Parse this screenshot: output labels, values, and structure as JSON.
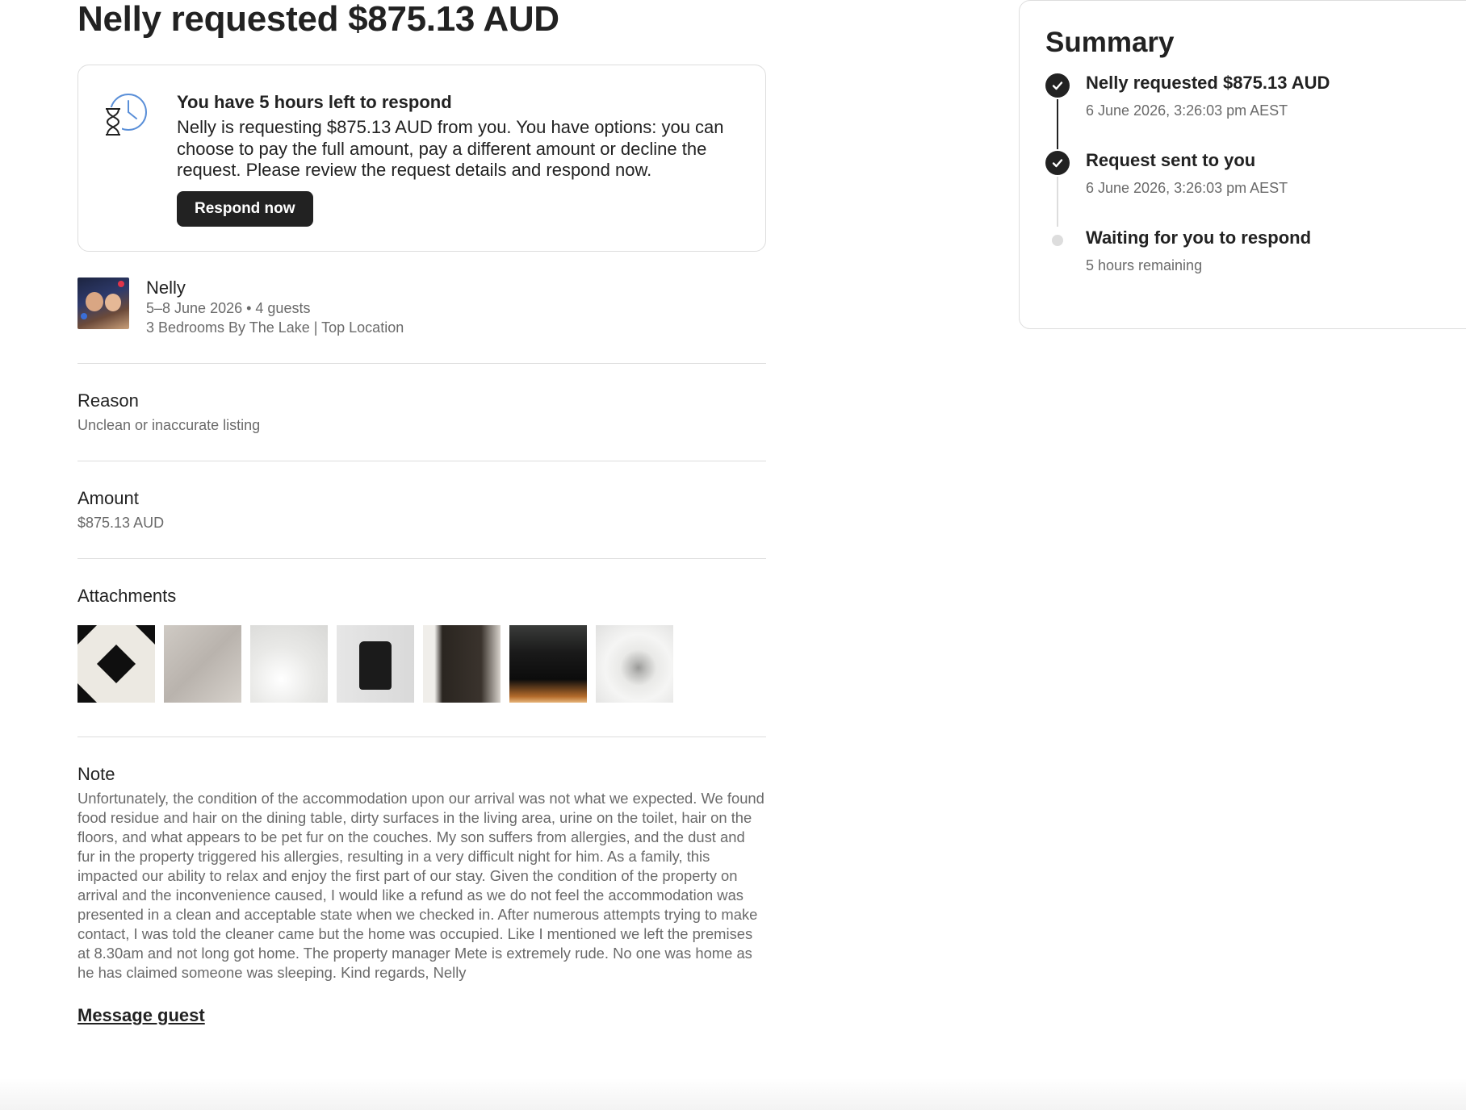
{
  "page": {
    "title": "Nelly requested $875.13 AUD"
  },
  "alert": {
    "heading": "You have 5 hours left to respond",
    "body": "Nelly is requesting $875.13 AUD from you. You have options: you can choose to pay the full amount, pay a different amount or decline the request. Please review the request details and respond now.",
    "button_label": "Respond now",
    "icon": "clock-hourglass-icon"
  },
  "guest": {
    "name": "Nelly",
    "dates_guests": "5–8 June 2026 • 4 guests",
    "listing": "3 Bedrooms By The Lake | Top Location"
  },
  "reason": {
    "label": "Reason",
    "value": "Unclean or inaccurate listing"
  },
  "amount": {
    "label": "Amount",
    "value": "$875.13 AUD"
  },
  "attachments": {
    "label": "Attachments",
    "count": 7
  },
  "note": {
    "label": "Note",
    "text": "Unfortunately, the condition of the accommodation upon our arrival was not what we expected. We found food residue and hair on the dining table, dirty surfaces in the living area, urine on the toilet, hair on the floors, and what appears to be pet fur on the couches. My son suffers from allergies, and the dust and fur in the property triggered his allergies, resulting in a very difficult night for him. As a family, this impacted our ability to relax and enjoy the first part of our stay. Given the condition of the property on arrival and the inconvenience caused, I would like a refund as we do not feel the accommodation was presented in a clean and acceptable state when we checked in. After numerous attempts trying to make contact, I was told the cleaner came but the home was occupied. Like I mentioned we left the premises at 8.30am and not long got home. The property manager Mete is extremely rude. No one was home as he has claimed someone was sleeping. Kind regards, Nelly"
  },
  "message_link": "Message guest",
  "summary": {
    "title": "Summary",
    "steps": [
      {
        "title": "Nelly requested $875.13 AUD",
        "subtitle": "6 June 2026, 3:26:03 pm AEST",
        "status": "done"
      },
      {
        "title": "Request sent to you",
        "subtitle": "6 June 2026, 3:26:03 pm AEST",
        "status": "done"
      },
      {
        "title": "Waiting for you to respond",
        "subtitle": "5 hours remaining",
        "status": "pending"
      }
    ]
  },
  "colors": {
    "text": "#222222",
    "muted": "#6a6a6a",
    "border": "#dddddd",
    "icon_blue": "#5a8fd8"
  }
}
